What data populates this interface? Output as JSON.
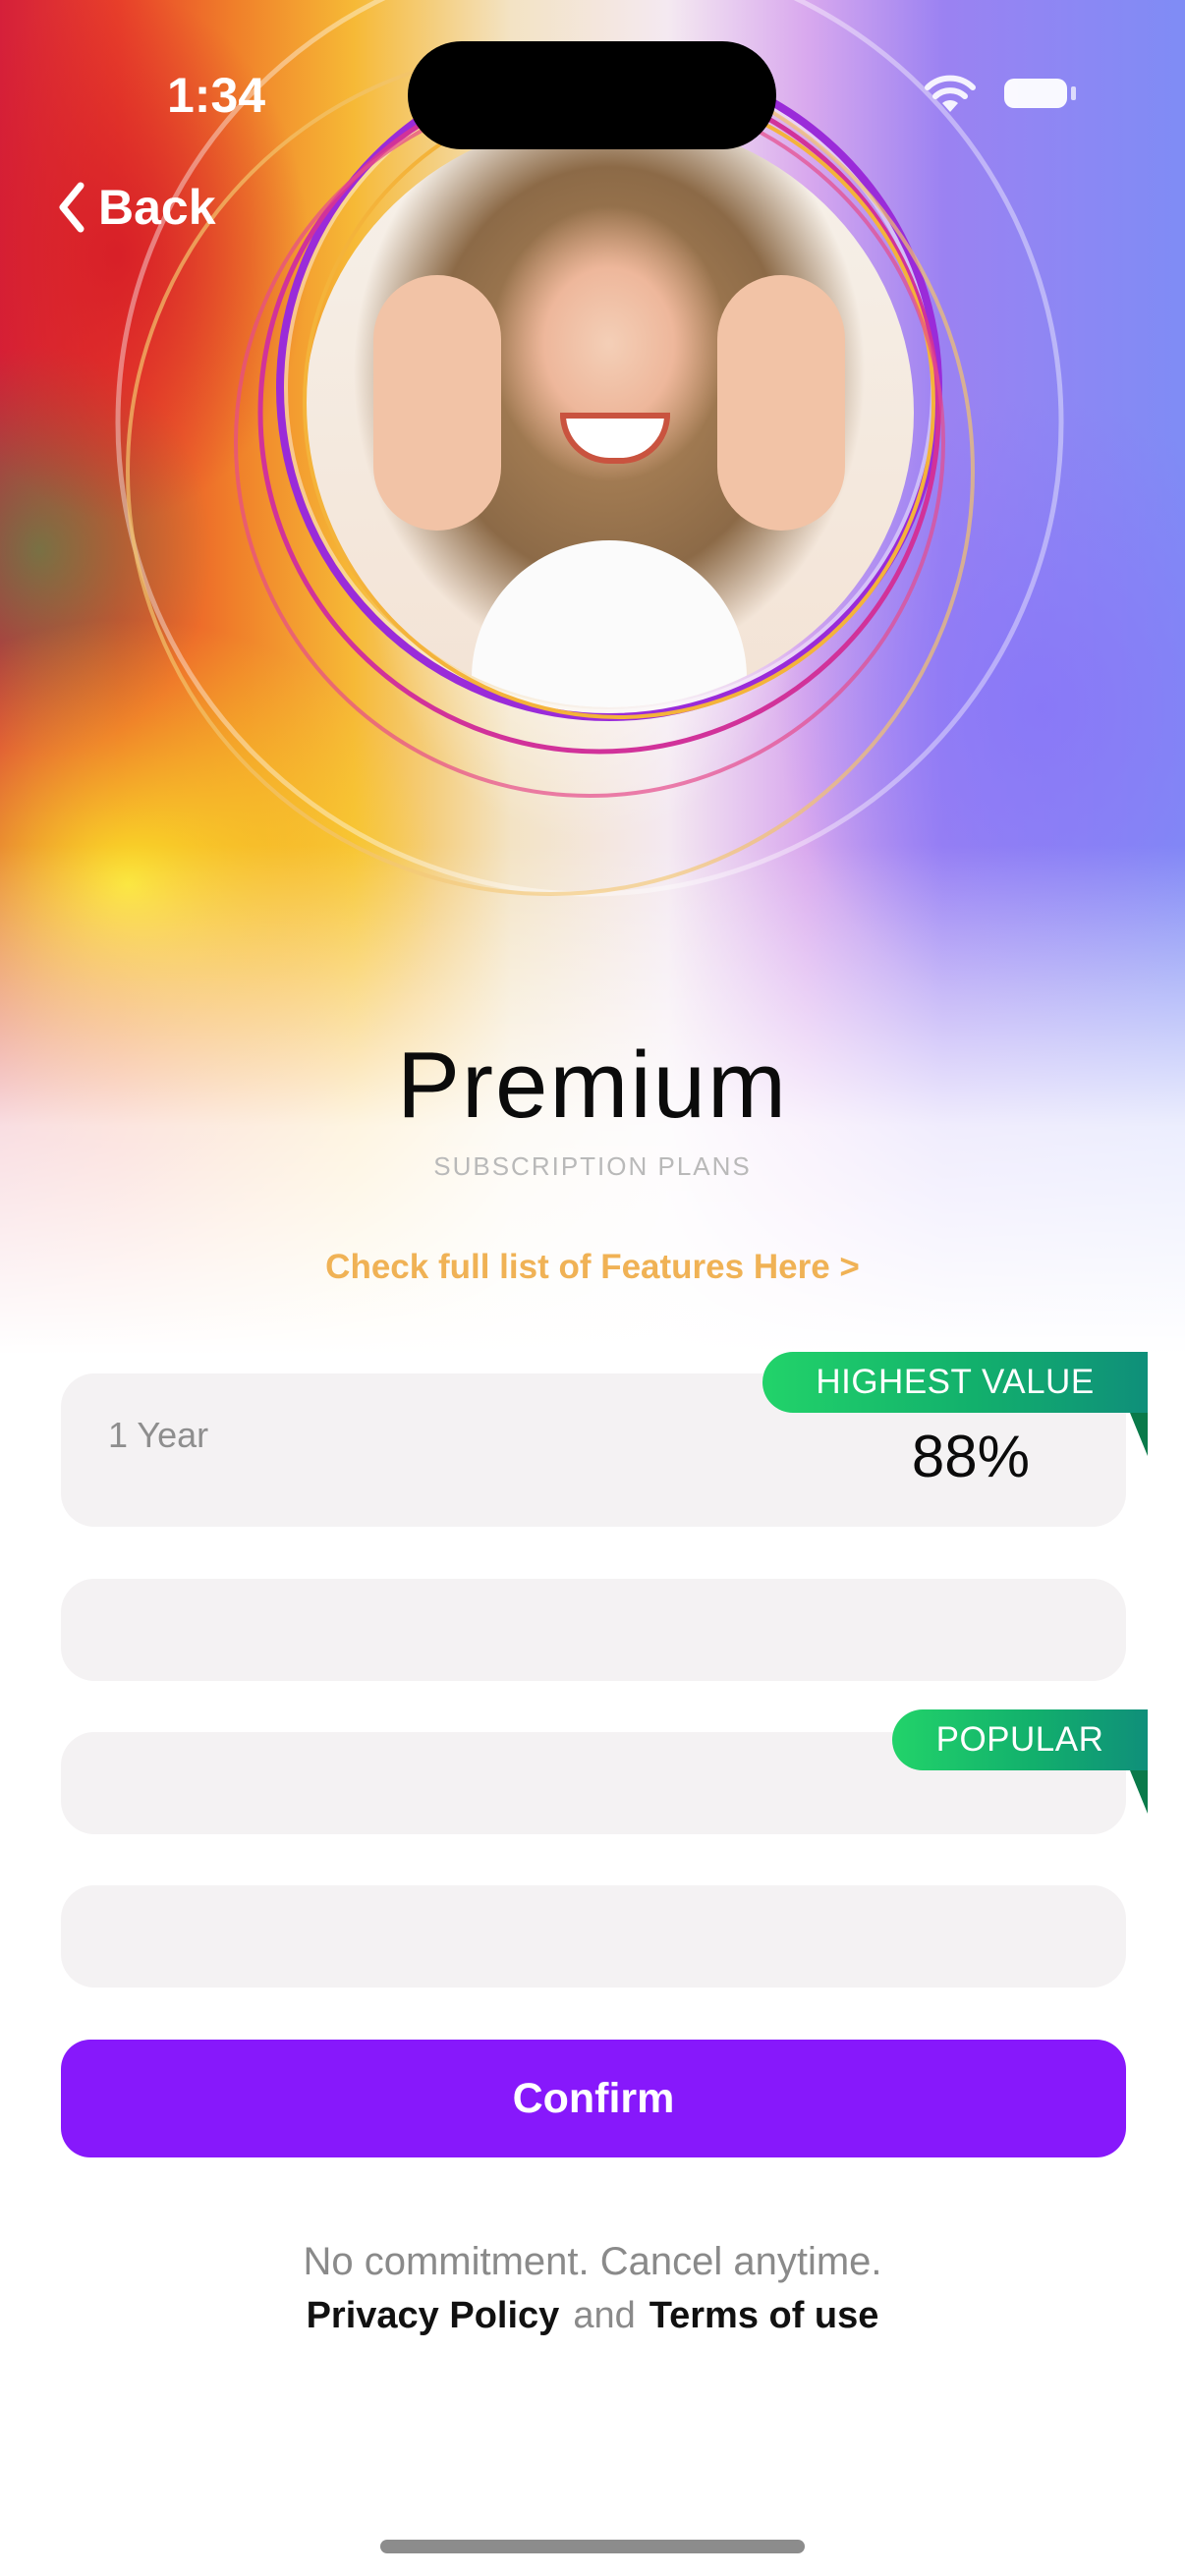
{
  "status_bar": {
    "time": "1:34",
    "icons": [
      "wifi-icon",
      "battery-icon"
    ]
  },
  "nav": {
    "back_label": "Back",
    "back_icon": "chevron-left-icon"
  },
  "header": {
    "title": "Premium",
    "subtitle": "SUBSCRIPTION PLANS",
    "features_link": "Check full list of Features Here >"
  },
  "plans": [
    {
      "label": "1 Year",
      "percent": "88%",
      "ribbon": "HIGHEST VALUE",
      "selected": true
    },
    {
      "label": "",
      "percent": "",
      "ribbon": ""
    },
    {
      "label": "",
      "percent": "",
      "ribbon": "POPULAR"
    },
    {
      "label": "",
      "percent": "",
      "ribbon": ""
    }
  ],
  "confirm_label": "Confirm",
  "footer": {
    "note": "No commitment. Cancel anytime.",
    "privacy_label": "Privacy Policy",
    "and_label": "and",
    "terms_label": "Terms of use"
  },
  "colors": {
    "accent": "#8718fb",
    "features_link": "#f0b255",
    "ribbon_green": "#12b06c",
    "plan_card": "#f4f2f3"
  }
}
